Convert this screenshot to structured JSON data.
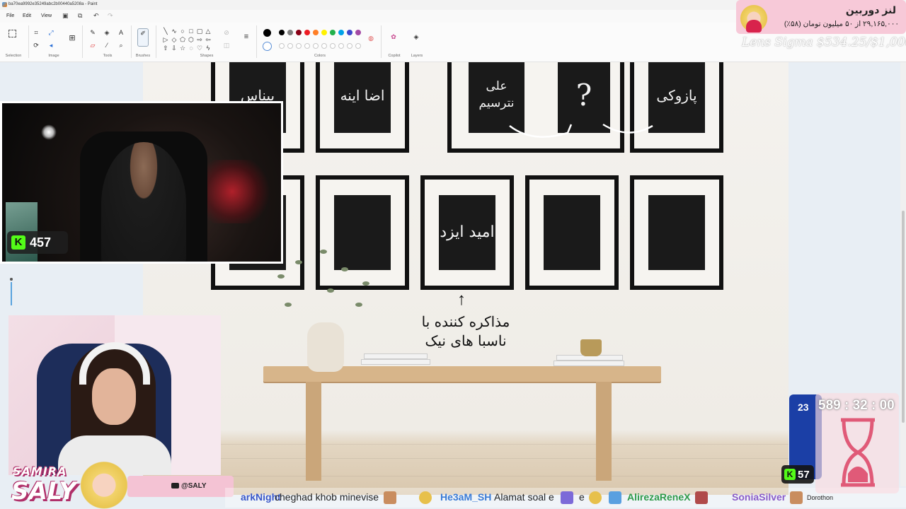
{
  "window": {
    "title": "ba70ea9992e35249abc2b00440a5208a - Paint"
  },
  "menu": {
    "file": "File",
    "edit": "Edit",
    "view": "View"
  },
  "ribbon": {
    "groups": {
      "selection": "Selection",
      "image": "Image",
      "tools": "Tools",
      "brushes": "Brushes",
      "shapes": "Shapes",
      "colors": "Colors",
      "copilot": "Copilot",
      "layers": "Layers"
    },
    "palette": [
      "#000000",
      "#7f7f7f",
      "#880015",
      "#ed1c24",
      "#ff7f27",
      "#fff200",
      "#22b14c",
      "#00a2e8",
      "#3f48cc",
      "#a349a4"
    ],
    "palette_row2": [
      "#ffffff",
      "#c3c3c3",
      "#b97a57",
      "#ffaec9",
      "#ffc90e",
      "#efe4b0",
      "#b5e61d",
      "#99d9ea",
      "#7092be",
      "#c8bfe7"
    ]
  },
  "canvas": {
    "frames_top": [
      {
        "text": "بیناس"
      },
      {
        "text": "اضا اینه"
      },
      {
        "text": ""
      },
      {
        "text": "علی نترسیم"
      },
      {
        "text": "?"
      },
      {
        "text": "پازوکی"
      }
    ],
    "frames_bottom": [
      {
        "text": ""
      },
      {
        "text": ""
      },
      {
        "text": "امید ایزد"
      },
      {
        "text": ""
      },
      {
        "text": ""
      }
    ],
    "annotation_arrow": "↑",
    "annotation_line1": "مذاکره کننده با",
    "annotation_line2": "ناسبا های نیک"
  },
  "streamer_cam": {
    "kick_viewers": "457"
  },
  "cohost": {
    "logo_line1": "SAMIRA",
    "logo_line2": "SALY",
    "social_handle": "@SALY"
  },
  "donation": {
    "name": "لنز دوربین",
    "amount": "۲۹,۱۶۵,۰۰۰ از ۵۰ میلیون تومان (۵۸٪)"
  },
  "goal": {
    "text": "Lens Sigma $534.25/$1,000"
  },
  "timer": {
    "count": "23",
    "time": "589 : 32 : 00"
  },
  "kick_small": {
    "viewers": "57"
  },
  "chat_ticker": [
    {
      "user": "arkNight",
      "message": "cheghad khob minevise",
      "color": "#3a57c8"
    },
    {
      "user": "He3aM_SH",
      "message": "Alamat soal e",
      "color": "#3a7bd5"
    },
    {
      "user": "e",
      "message": "",
      "color": "#222222"
    },
    {
      "user": "AlirezaReneX",
      "message": "",
      "color": "#2f9a4a"
    },
    {
      "user": "SoniaSilver",
      "message": "",
      "color": "#8a5cc8"
    },
    {
      "user": "Dorothon",
      "message": "",
      "color": "#222222"
    }
  ]
}
